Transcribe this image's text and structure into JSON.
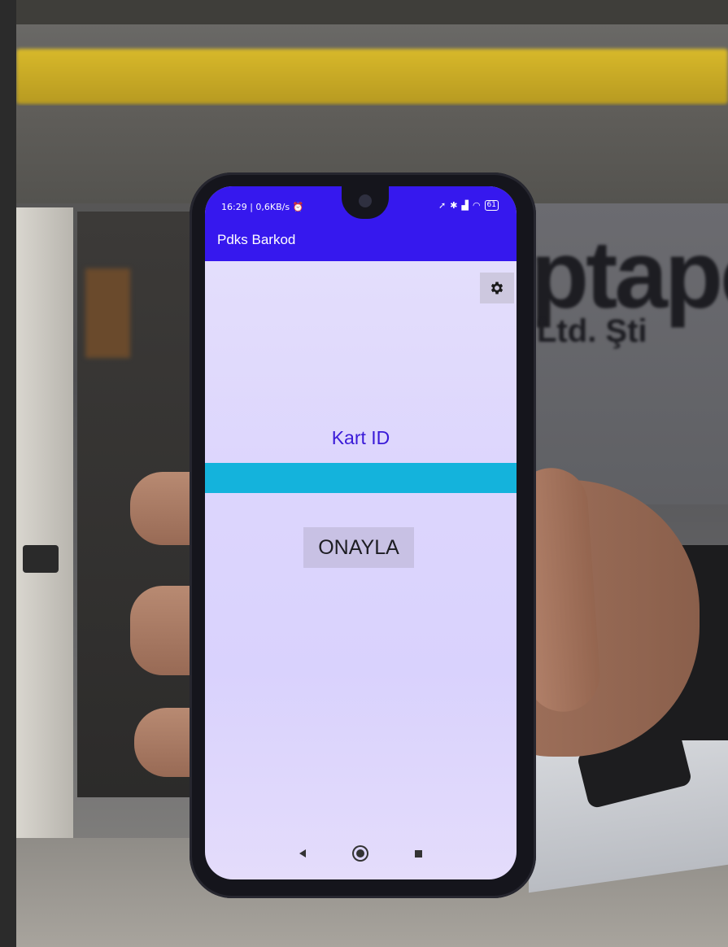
{
  "status_bar": {
    "time_network": "16:29 | 0,6KB/s",
    "icons": [
      "alarm-icon",
      "location-icon",
      "bluetooth-icon",
      "signal-icon",
      "wifi-icon"
    ],
    "battery": "61"
  },
  "app_bar": {
    "title": "Pdks Barkod",
    "color": "#3618ee"
  },
  "main": {
    "field_label": "Kart ID",
    "input_value": "",
    "input_color": "#14b3dc",
    "confirm_label": "ONAYLA",
    "settings_icon": "gear-icon"
  },
  "nav_bar": {
    "icons": [
      "back-icon",
      "home-icon",
      "recents-icon"
    ]
  },
  "background": {
    "sign_text": "ptape",
    "sign_subtext": "Ltd. Şti"
  }
}
